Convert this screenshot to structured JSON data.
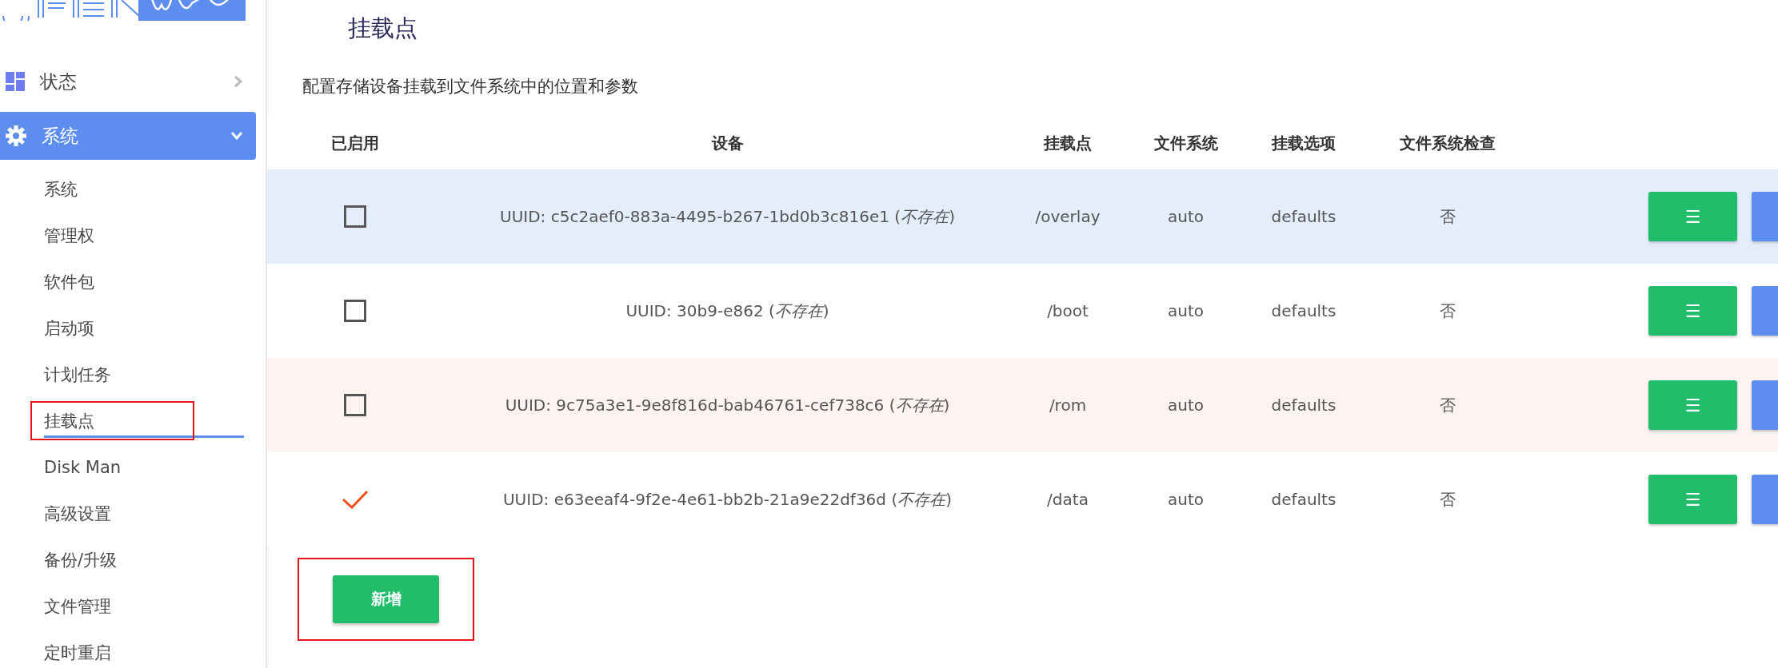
{
  "sidebar": {
    "menus": [
      {
        "label": "状态",
        "kind": "dashboard",
        "expanded": false,
        "selected": false
      },
      {
        "label": "系统",
        "kind": "gear",
        "expanded": true,
        "selected": true
      }
    ],
    "items": [
      {
        "label": "系统",
        "selected": false,
        "highlighted": false
      },
      {
        "label": "管理权",
        "selected": false,
        "highlighted": false
      },
      {
        "label": "软件包",
        "selected": false,
        "highlighted": false
      },
      {
        "label": "启动项",
        "selected": false,
        "highlighted": false
      },
      {
        "label": "计划任务",
        "selected": false,
        "highlighted": false
      },
      {
        "label": "挂载点",
        "selected": true,
        "highlighted": true
      },
      {
        "label": "Disk Man",
        "selected": false,
        "highlighted": false
      },
      {
        "label": "高级设置",
        "selected": false,
        "highlighted": false
      },
      {
        "label": "备份/升级",
        "selected": false,
        "highlighted": false
      },
      {
        "label": "文件管理",
        "selected": false,
        "highlighted": false
      },
      {
        "label": "定时重启",
        "selected": false,
        "highlighted": false
      }
    ]
  },
  "page": {
    "title": "挂载点",
    "description": "配置存储设备挂载到文件系统中的位置和参数"
  },
  "table": {
    "columns": [
      "已启用",
      "设备",
      "挂载点",
      "文件系统",
      "挂载选项",
      "文件系统检查"
    ],
    "rows": [
      {
        "enabled": false,
        "highlighted": true,
        "device": "UUID: c5c2aef0-883a-4495-b267-1bd0b3c816e1 (*不存在*)",
        "mount_point": "/overlay",
        "filesystem": "auto",
        "options": "defaults",
        "fsck": "否",
        "edit_label": "☰"
      },
      {
        "enabled": false,
        "highlighted": false,
        "device": "UUID: 30b9-e862 (*不存在*)",
        "mount_point": "/boot",
        "filesystem": "auto",
        "options": "defaults",
        "fsck": "否",
        "edit_label": "☰"
      },
      {
        "enabled": false,
        "highlighted": false,
        "device": "UUID: 9c75a3e1-9e8f816d-bab46761-cef738c6 (*不存在*)",
        "mount_point": "/rom",
        "filesystem": "auto",
        "options": "defaults",
        "fsck": "否",
        "edit_label": "☰"
      },
      {
        "enabled": true,
        "highlighted": false,
        "device": "UUID: e63eeaf4-9f2e-4e61-bb2b-21a9e22df36d (*不存在*)",
        "mount_point": "/data",
        "filesystem": "auto",
        "options": "defaults",
        "fsck": "否",
        "edit_label": "☰"
      }
    ]
  },
  "add_button": {
    "label": "新增",
    "highlighted": true
  }
}
